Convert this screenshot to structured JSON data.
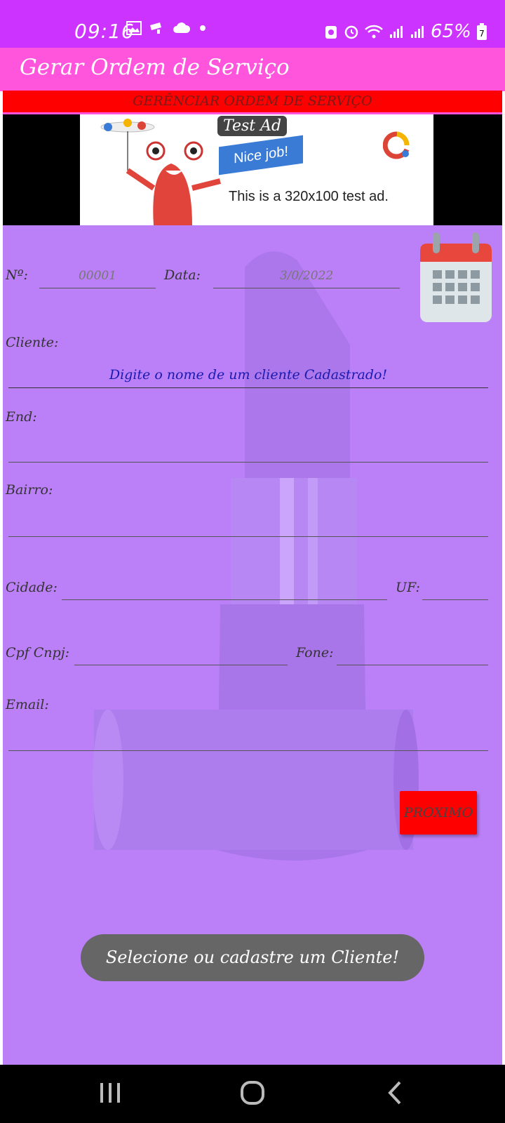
{
  "status_bar": {
    "time": "09:16",
    "battery": "65%",
    "battery_digit": "7"
  },
  "app_bar": {
    "title": "Gerar Ordem de Serviço"
  },
  "header": {
    "title": "GERÊNCIAR ORDEM DE SERVIÇO"
  },
  "ad": {
    "badge": "Test Ad",
    "flag": "Nice job!",
    "text": "This is a 320x100 test ad."
  },
  "form": {
    "numero_label": "Nº:",
    "numero_value": "00001",
    "data_label": "Data:",
    "data_value": "3/0/2022",
    "cliente_label": "Cliente:",
    "cliente_hint": "Digite o nome de um cliente Cadastrado!",
    "end_label": "End:",
    "bairro_label": "Bairro:",
    "cidade_label": "Cidade:",
    "uf_label": "UF:",
    "cpf_label": "Cpf Cnpj:",
    "fone_label": "Fone:",
    "email_label": "Email:",
    "proximo_label": "PROXIMO"
  },
  "toast": {
    "message": "Selecione ou cadastre um Cliente!"
  },
  "colors": {
    "status_bar": "#cc33ff",
    "app_bar": "#ff55dd",
    "header": "#ff0000",
    "form_bg": "#bb80f7",
    "button": "#ff0000"
  }
}
